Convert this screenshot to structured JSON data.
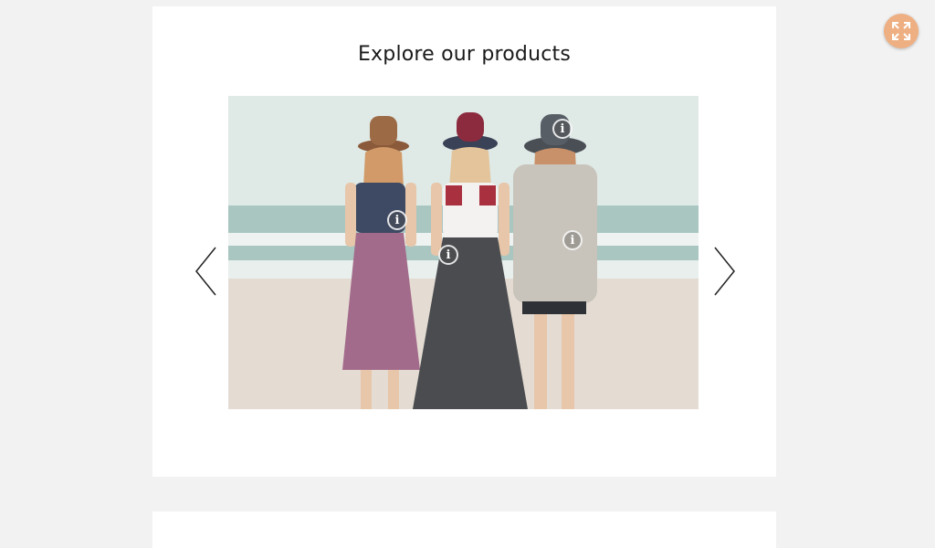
{
  "page": {
    "title": "Explore our products"
  },
  "carousel": {
    "prev_icon": "chevron-left-icon",
    "next_icon": "chevron-right-icon",
    "hotspots": [
      {
        "label": "i",
        "icon": "info-icon"
      },
      {
        "label": "i",
        "icon": "info-icon"
      },
      {
        "label": "i",
        "icon": "info-icon"
      },
      {
        "label": "i",
        "icon": "info-icon"
      }
    ]
  },
  "controls": {
    "fullscreen_icon": "expand-icon"
  },
  "colors": {
    "background": "#f2f2f2",
    "card": "#ffffff",
    "accent": "#eeb083"
  }
}
